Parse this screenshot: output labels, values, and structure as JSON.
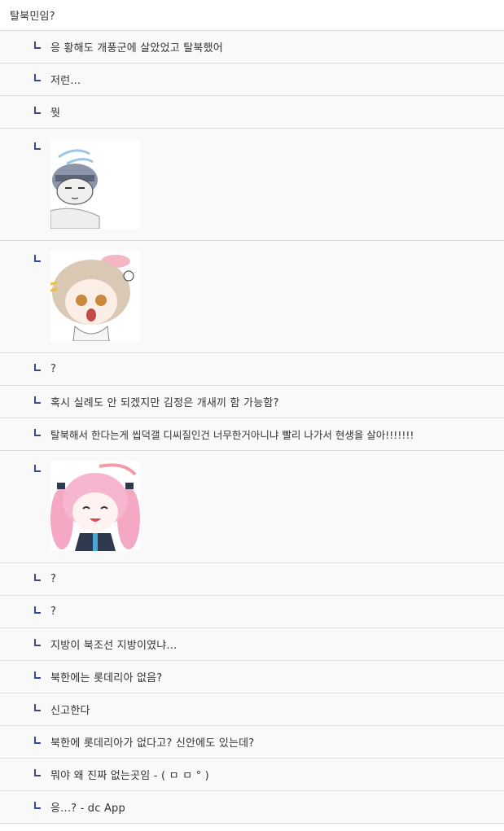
{
  "post": {
    "text": "탈북민임?"
  },
  "replies": [
    {
      "type": "text",
      "text": "응 황해도 개풍군에 살았었고 탈북했어"
    },
    {
      "type": "text",
      "text": "저런..."
    },
    {
      "type": "text",
      "text": "뭣"
    },
    {
      "type": "image",
      "sticker": "grey-haired-chibi-sticker"
    },
    {
      "type": "image",
      "sticker": "surprised-blonde-chibi-sticker"
    },
    {
      "type": "text",
      "text": "?"
    },
    {
      "type": "text",
      "text": "혹시 실례도 안 되겠지만 김정은 개새끼 함 가능함?"
    },
    {
      "type": "text",
      "text": "탈북해서 한다는게 씹덕갤 디씨질인건 너무한거아니냐 빨리 나가서 현생을 살아!!!!!!!"
    },
    {
      "type": "image",
      "sticker": "pink-twintail-chibi-sticker"
    },
    {
      "type": "text",
      "text": "?"
    },
    {
      "type": "text",
      "text": "?"
    },
    {
      "type": "text",
      "text": "지방이 북조선 지방이였냐..."
    },
    {
      "type": "text",
      "text": "북한에는 롯데리아 없음?"
    },
    {
      "type": "text",
      "text": "신고한다"
    },
    {
      "type": "text",
      "text": "북한에 롯데리아가 없다고? 신안에도 있는데?"
    },
    {
      "type": "text",
      "text": "뭐야 왜 진짜 없는곳임 - ( ㅁ ㅁ ° )"
    },
    {
      "type": "text",
      "text": "응...? - dc App"
    }
  ],
  "icons": {
    "reply_marker": "reply-arrow-icon"
  },
  "colors": {
    "reply_marker": "#3a4a8a",
    "divider": "#dcdcdc",
    "reply_bg": "#f9f9f9"
  }
}
